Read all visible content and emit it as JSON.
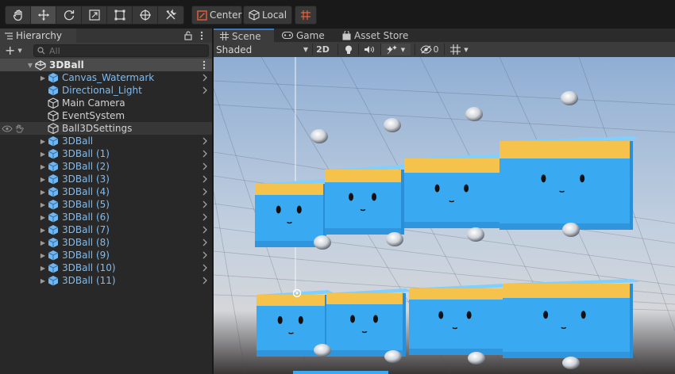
{
  "toolbar": {
    "tools": [
      {
        "icon": "hand-tool-icon"
      },
      {
        "icon": "move-tool-icon",
        "active": true
      },
      {
        "icon": "rotate-tool-icon"
      },
      {
        "icon": "scale-tool-icon"
      },
      {
        "icon": "rect-tool-icon"
      },
      {
        "icon": "transform-tool-icon"
      },
      {
        "icon": "custom-tool-icon"
      }
    ],
    "pivot_label": "Center",
    "space_label": "Local",
    "snap_icon": "grid-snap-icon",
    "accent": "#e8613a"
  },
  "hierarchy": {
    "tab_label": "Hierarchy",
    "search_placeholder": "All",
    "scene_name": "3DBall",
    "items": [
      {
        "label": "Canvas_Watermark",
        "prefab": true,
        "expandable": true
      },
      {
        "label": "Directional_Light",
        "prefab": true,
        "expandable": false
      },
      {
        "label": "Main Camera",
        "prefab": false,
        "expandable": false
      },
      {
        "label": "EventSystem",
        "prefab": false,
        "expandable": false
      },
      {
        "label": "Ball3DSettings",
        "prefab": false,
        "expandable": false,
        "selected": true
      },
      {
        "label": "3DBall",
        "prefab": true,
        "expandable": true
      },
      {
        "label": "3DBall (1)",
        "prefab": true,
        "expandable": true
      },
      {
        "label": "3DBall (2)",
        "prefab": true,
        "expandable": true
      },
      {
        "label": "3DBall (3)",
        "prefab": true,
        "expandable": true
      },
      {
        "label": "3DBall (4)",
        "prefab": true,
        "expandable": true
      },
      {
        "label": "3DBall (5)",
        "prefab": true,
        "expandable": true
      },
      {
        "label": "3DBall (6)",
        "prefab": true,
        "expandable": true
      },
      {
        "label": "3DBall (7)",
        "prefab": true,
        "expandable": true
      },
      {
        "label": "3DBall (8)",
        "prefab": true,
        "expandable": true
      },
      {
        "label": "3DBall (9)",
        "prefab": true,
        "expandable": true
      },
      {
        "label": "3DBall (10)",
        "prefab": true,
        "expandable": true
      },
      {
        "label": "3DBall (11)",
        "prefab": true,
        "expandable": true
      }
    ],
    "prefab_color": "#7cbdf5"
  },
  "scene_tabs": [
    {
      "label": "Scene",
      "icon": "grid-icon",
      "active": true
    },
    {
      "label": "Game",
      "icon": "gamepad-icon",
      "active": false
    },
    {
      "label": "Asset Store",
      "icon": "bag-icon",
      "active": false
    }
  ],
  "scene_toolbar": {
    "draw_mode": "Shaded",
    "mode_2d": "2D",
    "hidden_count": "0"
  },
  "viewport": {
    "sky_color": "#9fb8d6",
    "platform_color": "#39a9f2",
    "platform_top_color": "#f5c24b"
  }
}
